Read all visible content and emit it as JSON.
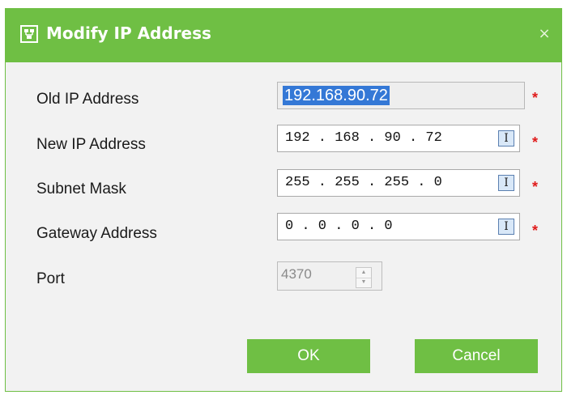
{
  "dialog": {
    "title": "Modify IP Address",
    "close_symbol": "×",
    "title_icon": "network-config-icon",
    "accent_color": "#6fbf44"
  },
  "form": {
    "old_ip": {
      "label": "Old IP Address",
      "value": "192.168.90.72",
      "required": "*"
    },
    "new_ip": {
      "label": "New IP Address",
      "value": "192 . 168 . 90 . 72",
      "required": "*"
    },
    "subnet": {
      "label": "Subnet Mask",
      "value": "255 . 255 . 255 . 0",
      "required": "*"
    },
    "gateway": {
      "label": "Gateway Address",
      "value": "0 . 0 . 0 . 0",
      "required": "*"
    },
    "port": {
      "label": "Port",
      "value": "4370"
    },
    "ip_button_glyph": "I"
  },
  "buttons": {
    "ok": "OK",
    "cancel": "Cancel"
  }
}
